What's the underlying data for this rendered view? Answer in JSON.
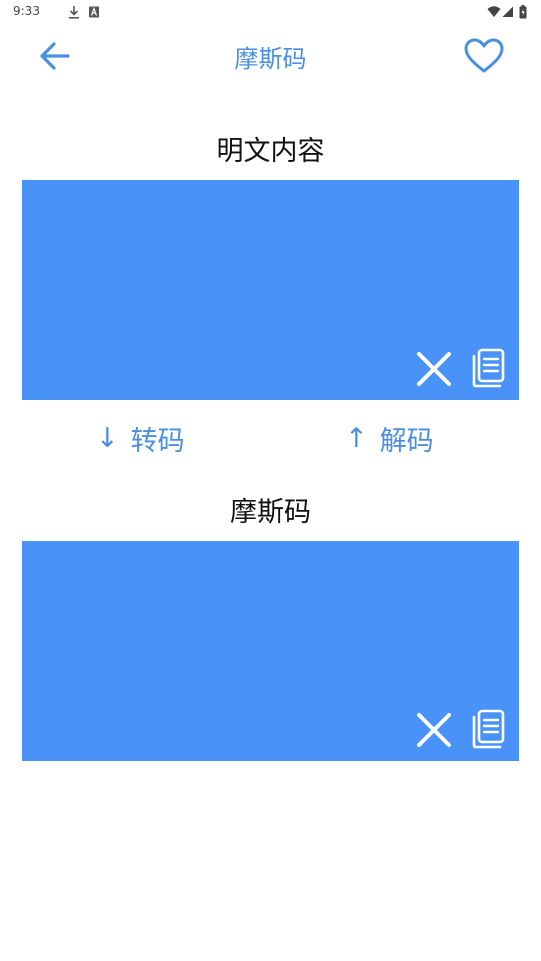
{
  "status_bar": {
    "time": "9:33",
    "icons": [
      "download-icon",
      "a-box-icon",
      "wifi-icon",
      "signal-icon",
      "battery-icon"
    ]
  },
  "header": {
    "title": "摩斯码",
    "back_icon": "arrow-left-icon",
    "favorite_icon": "heart-icon"
  },
  "plain_section": {
    "label": "明文内容",
    "value": "",
    "clear_icon": "close-icon",
    "copy_icon": "copy-icon"
  },
  "actions": {
    "encode_arrow": "↓",
    "encode_label": "转码",
    "decode_arrow": "↑",
    "decode_label": "解码"
  },
  "morse_section": {
    "label": "摩斯码",
    "value": "",
    "clear_icon": "close-icon",
    "copy_icon": "copy-icon"
  },
  "colors": {
    "accent": "#4A90E2",
    "box": "#4993F8",
    "icon_white": "#FFFFFF"
  }
}
